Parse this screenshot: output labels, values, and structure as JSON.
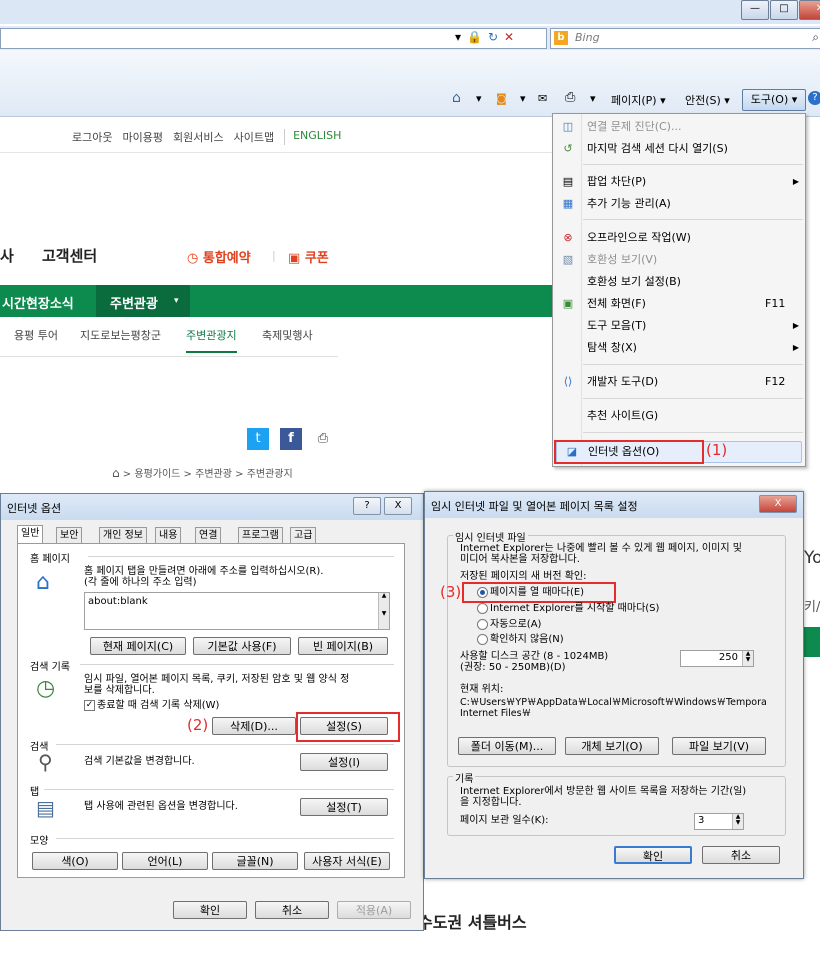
{
  "browser": {
    "search_placeholder": "Bing",
    "commands": {
      "page": "페이지(P) ▾",
      "safety": "안전(S) ▾",
      "tools": "도구(O) ▾"
    }
  },
  "site": {
    "top_links": [
      "로그아웃",
      "마이용평",
      "회원서비스",
      "사이트맵"
    ],
    "english": "ENGLISH",
    "nav_fragment": "사",
    "customer_center": "고객센터",
    "reservation": "통합예약",
    "coupon": "쿠폰",
    "green_menu": [
      "시간현장소식",
      "주변관광"
    ],
    "sub_menu": [
      "용평 투어",
      "지도로보는평창군",
      "주변관광지",
      "축제및행사"
    ],
    "breadcrumb": [
      "용평가이드",
      "주변관광",
      "주변관광지"
    ],
    "bottom_text": "수도권 셔틀버스",
    "right_fragments": [
      "Yo",
      "키/"
    ]
  },
  "tools_menu": {
    "items": [
      {
        "label": "연결 문제 진단(C)...",
        "disabled": true
      },
      {
        "label": "마지막 검색 세션 다시 열기(S)"
      },
      {
        "label": "팝업 차단(P)",
        "submenu": true
      },
      {
        "label": "추가 기능 관리(A)"
      },
      {
        "label": "오프라인으로 작업(W)"
      },
      {
        "label": "호환성 보기(V)",
        "disabled": true
      },
      {
        "label": "호환성 보기 설정(B)"
      },
      {
        "label": "전체 화면(F)",
        "shortcut": "F11"
      },
      {
        "label": "도구 모음(T)",
        "submenu": true
      },
      {
        "label": "탐색 창(X)",
        "submenu": true
      },
      {
        "label": "개발자 도구(D)",
        "shortcut": "F12"
      },
      {
        "label": "추천 사이트(G)"
      },
      {
        "label": "인터넷 옵션(O)"
      }
    ]
  },
  "annotations": [
    "(1)",
    "(2)",
    "(3)"
  ],
  "internet_options": {
    "title": "인터넷 옵션",
    "title_buttons": [
      "?",
      "X"
    ],
    "tabs": [
      "일반",
      "보안",
      "개인 정보",
      "내용",
      "연결",
      "프로그램",
      "고급"
    ],
    "home": {
      "label": "홈 페이지",
      "desc": "홈 페이지 탭을 만들려면 아래에 주소를 입력하십시오(R).\n(각 줄에 하나의 주소 입력)",
      "value": "about:blank",
      "buttons": [
        "현재 페이지(C)",
        "기본값 사용(F)",
        "빈 페이지(B)"
      ]
    },
    "history": {
      "label": "검색 기록",
      "desc": "임시 파일, 열어본 페이지 목록, 쿠키, 저장된 암호 및 웹 양식 정\n보를 삭제합니다.",
      "checkbox": "종료할 때 검색 기록 삭제(W)",
      "delete": "삭제(D)...",
      "settings": "설정(S)"
    },
    "search": {
      "label": "검색",
      "desc": "검색 기본값을 변경합니다.",
      "settings": "설정(I)"
    },
    "tabs_section": {
      "label": "탭",
      "desc": "탭 사용에 관련된 옵션을 변경합니다.",
      "settings": "설정(T)"
    },
    "appearance": {
      "label": "모양",
      "buttons": [
        "색(O)",
        "언어(L)",
        "글꼴(N)",
        "사용자 서식(E)"
      ]
    },
    "footer": [
      "확인",
      "취소",
      "적용(A)"
    ]
  },
  "temp_dialog": {
    "title": "임시 인터넷 파일 및 열어본 페이지 목록 설정",
    "close": "X",
    "group1": {
      "label": "임시 인터넷 파일",
      "desc": "Internet Explorer는 나중에 빨리 볼 수 있게 웹 페이지, 이미지 및\n미디어 복사본을 저장합니다.",
      "check_label": "저장된 페이지의 새 버전 확인:",
      "options": [
        "페이지를 열 때마다(E)",
        "Internet Explorer를 시작할 때마다(S)",
        "자동으로(A)",
        "확인하지 않음(N)"
      ],
      "selected_option": "페이지를 열 때마다(E)",
      "disk_label": "사용할 디스크 공간 (8 - 1024MB)\n(권장: 50 - 250MB)(D)",
      "disk_value": "250",
      "location_label": "현재 위치:",
      "location_path": "C:￦Users￦YP￦AppData￦Local￦Microsoft￦Windows￦Tempora\nInternet Files￦",
      "buttons": [
        "폴더 이동(M)...",
        "개체 보기(O)",
        "파일 보기(V)"
      ]
    },
    "group2": {
      "label": "기록",
      "desc": "Internet Explorer에서 방문한 웹 사이트 목록을 저장하는 기간(일)\n을 지정합니다.",
      "days_label": "페이지 보관 일수(K):",
      "days_value": "3"
    },
    "footer": [
      "확인",
      "취소"
    ]
  },
  "colors": {
    "accent_green": "#0d8a4e",
    "highlight_red": "#e52b2b",
    "reserve_orange": "#e0421f"
  }
}
